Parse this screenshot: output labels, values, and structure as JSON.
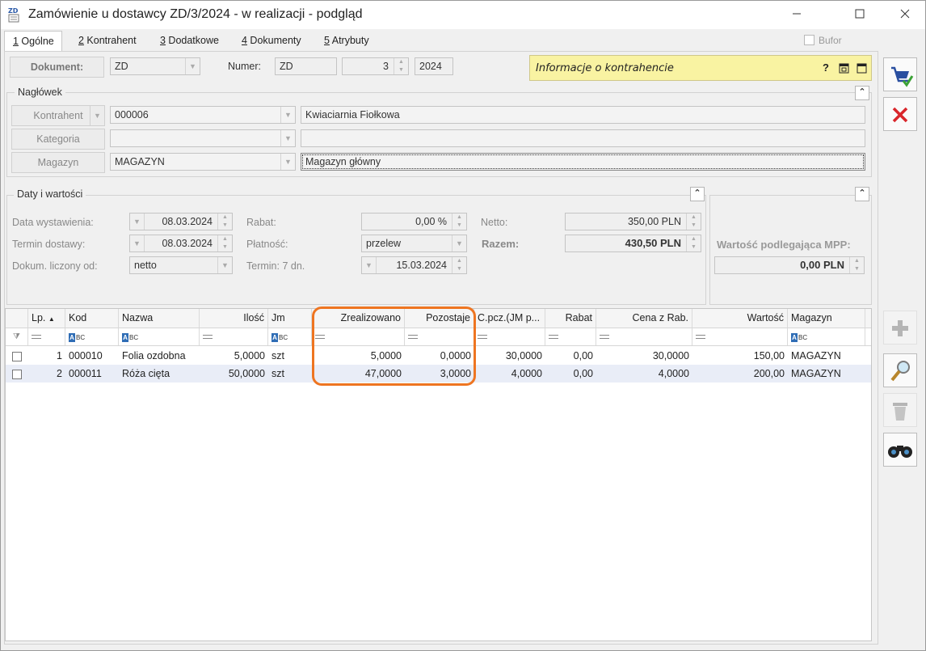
{
  "window": {
    "icon_text": "ZD",
    "title": "Zamówienie u dostawcy ZD/3/2024 - w realizacji - podgląd",
    "minimize": "—",
    "maximize": "☐",
    "close": "✕"
  },
  "tabs": [
    {
      "key": "1",
      "label": " Ogólne"
    },
    {
      "key": "2",
      "label": " Kontrahent"
    },
    {
      "key": "3",
      "label": " Dodatkowe"
    },
    {
      "key": "4",
      "label": " Dokumenty"
    },
    {
      "key": "5",
      "label": " Atrybuty"
    }
  ],
  "bufor_label": "Bufor",
  "document": {
    "button_label": "Dokument:",
    "type_value": "ZD",
    "numer_label": "Numer:",
    "numer_prefix": "ZD",
    "numer_value": "3",
    "numer_year": "2024"
  },
  "info_panel": {
    "title": "Informacje o kontrahencie",
    "help": "?"
  },
  "naglowek": {
    "title": "Nagłówek",
    "kontrahent_label": "Kontrahent",
    "kontrahent_code": "000006",
    "kontrahent_name": "Kwiaciarnia Fiołkowa",
    "kategoria_label": "Kategoria",
    "kategoria_value": "",
    "kategoria_desc": "",
    "magazyn_label": "Magazyn",
    "magazyn_code": "MAGAZYN",
    "magazyn_name": "Magazyn główny"
  },
  "daty": {
    "title": "Daty i wartości",
    "data_wystawienia_label": "Data wystawienia:",
    "data_wystawienia": "08.03.2024",
    "termin_dostawy_label": "Termin dostawy:",
    "termin_dostawy": "08.03.2024",
    "dokum_liczony_label": "Dokum. liczony od:",
    "dokum_liczony": "netto",
    "rabat_label": "Rabat:",
    "rabat": "0,00 %",
    "platnosc_label": "Płatność:",
    "platnosc": "przelew",
    "termin_label": "Termin: 7 dn.",
    "termin": "15.03.2024",
    "netto_label": "Netto:",
    "netto": "350,00 PLN",
    "razem_label": "Razem:",
    "razem": "430,50 PLN"
  },
  "mpp": {
    "label": "Wartość podlegająca MPP:",
    "value": "0,00 PLN"
  },
  "grid": {
    "columns": [
      "Lp.",
      "Kod",
      "Nazwa",
      "Ilość",
      "Jm",
      "Zrealizowano",
      "Pozostaje",
      "C.pcz.(JM p...",
      "Rabat",
      "Cena z Rab.",
      "Wartość",
      "Magazyn"
    ],
    "rows": [
      {
        "lp": "1",
        "kod": "000010",
        "nazwa": "Folia ozdobna",
        "ilosc": "5,0000",
        "jm": "szt",
        "zrealizowano": "5,0000",
        "pozostaje": "0,0000",
        "cpcz": "30,0000",
        "rabat": "0,00",
        "cena": "30,0000",
        "wartosc": "150,00",
        "magazyn": "MAGAZYN"
      },
      {
        "lp": "2",
        "kod": "000011",
        "nazwa": "Róża cięta",
        "ilosc": "50,0000",
        "jm": "szt",
        "zrealizowano": "47,0000",
        "pozostaje": "3,0000",
        "cpcz": "4,0000",
        "rabat": "0,00",
        "cena": "4,0000",
        "wartosc": "200,00",
        "magazyn": "MAGAZYN"
      }
    ]
  },
  "colors": {
    "info_bg": "#f9f3a2",
    "highlight": "#ee7521",
    "selected_row": "#e9edf7"
  }
}
